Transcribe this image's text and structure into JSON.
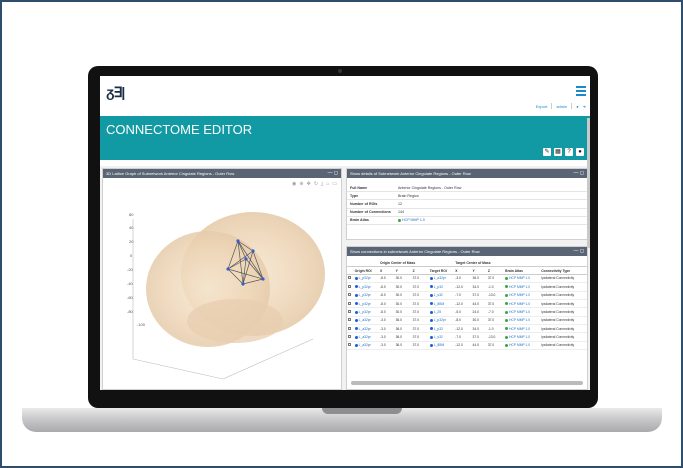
{
  "app": {
    "logo_text": "ᵹ∃|",
    "title": "CONNECTOME EDITOR",
    "links": {
      "export": "Export",
      "admin": "admin"
    }
  },
  "graph_panel": {
    "title": "3D Lattice Graph of Subnetwork Anterior Cingulate Regions - Outer Row",
    "y_ticks": [
      "80",
      "40",
      "20",
      "0",
      "-20",
      "-40",
      "-60",
      "-80",
      "-100"
    ]
  },
  "details_panel": {
    "title": "Show details of Subnetwork Anterior Cingulate Regions - Outer Row",
    "rows": [
      {
        "k": "Full Name",
        "v": "Anterior Cingulate Regions - Outer Row"
      },
      {
        "k": "Type",
        "v": "Brain Region"
      },
      {
        "k": "Number of ROIs",
        "v": "12"
      },
      {
        "k": "Number of Connections",
        "v": "144"
      },
      {
        "k": "Brain Atlas",
        "v": "HCP MMP 1.0"
      }
    ]
  },
  "connections_panel": {
    "title": "Show connections in subnetwork Anterior Cingulate Regions - Outer Row",
    "group_headers": [
      "Origin Center of Mass",
      "Target Center of Mass"
    ],
    "columns": [
      "Origin ROI",
      "X",
      "Y",
      "Z",
      "Target ROI",
      "X",
      "Y",
      "Z",
      "Brain Atlas",
      "Connectivity Type"
    ],
    "rows": [
      [
        "L_p32pr",
        "-8.0",
        "30.0",
        "37.0",
        "L_a32pr",
        "-3.0",
        "36.0",
        "37.0",
        "HCP MMP 1.0",
        "Ipsilateral Connectivity"
      ],
      [
        "L_p32pr",
        "-8.0",
        "30.0",
        "37.0",
        "L_p32",
        "-12.0",
        "34.0",
        "-1.0",
        "HCP MMP 1.0",
        "Ipsilateral Connectivity"
      ],
      [
        "L_p32pr",
        "-8.0",
        "30.0",
        "37.0",
        "L_s32",
        "-7.0",
        "37.0",
        "-13.0",
        "HCP MMP 1.0",
        "Ipsilateral Connectivity"
      ],
      [
        "L_p32pr",
        "-8.0",
        "30.0",
        "37.0",
        "L_8BM",
        "-12.0",
        "44.0",
        "37.0",
        "HCP MMP 1.0",
        "Ipsilateral Connectivity"
      ],
      [
        "L_p32pr",
        "-8.0",
        "30.0",
        "37.0",
        "L_25",
        "-5.0",
        "24.0",
        "-7.0",
        "HCP MMP 1.0",
        "Ipsilateral Connectivity"
      ],
      [
        "L_a32pr",
        "-3.0",
        "36.0",
        "37.0",
        "L_p32pr",
        "-8.0",
        "30.0",
        "37.0",
        "HCP MMP 1.0",
        "Ipsilateral Connectivity"
      ],
      [
        "L_a32pr",
        "-3.0",
        "36.0",
        "37.0",
        "L_p32",
        "-12.0",
        "34.0",
        "-1.0",
        "HCP MMP 1.0",
        "Ipsilateral Connectivity"
      ],
      [
        "L_a32pr",
        "-3.0",
        "36.0",
        "37.0",
        "L_s32",
        "-7.0",
        "37.0",
        "-13.0",
        "HCP MMP 1.0",
        "Ipsilateral Connectivity"
      ],
      [
        "L_a32pr",
        "-3.0",
        "36.0",
        "37.0",
        "L_8BM",
        "-12.0",
        "44.0",
        "37.0",
        "HCP MMP 1.0",
        "Ipsilateral Connectivity"
      ]
    ]
  },
  "colors": {
    "banner": "#119aa3",
    "panel_head": "#596574",
    "link": "#1a6fc9"
  }
}
